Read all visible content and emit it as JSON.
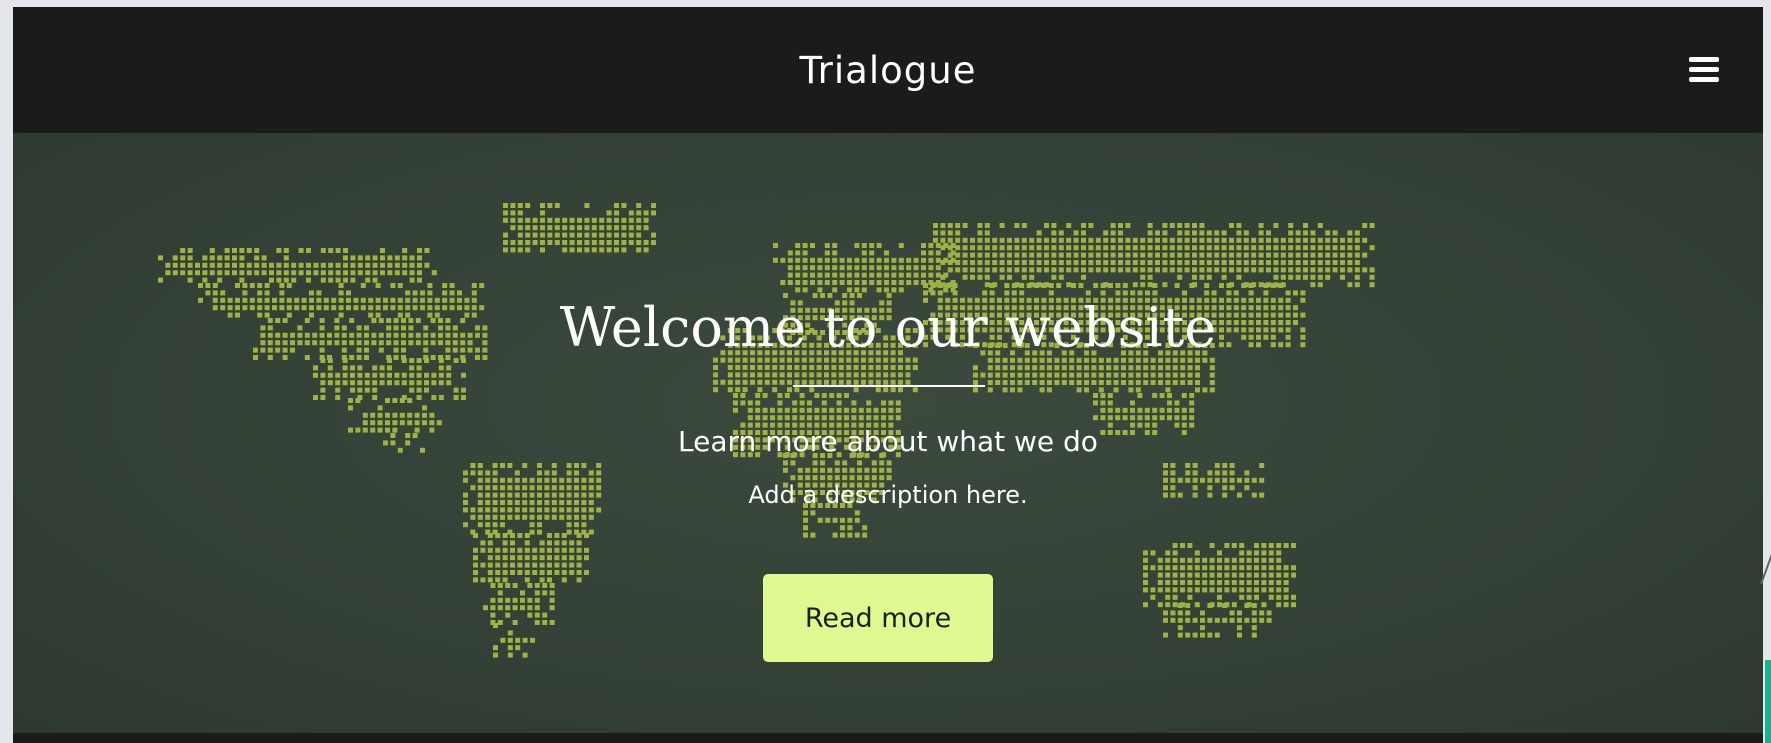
{
  "header": {
    "brand": "Trialogue",
    "menu_icon": "hamburger-menu-icon"
  },
  "hero": {
    "background_image": "world-dot-map",
    "title": "Welcome to our website",
    "subtitle": "Learn more about what we do",
    "description": "Add a description here.",
    "button_label": "Read more"
  },
  "colors": {
    "header_bg": "#1b1b1b",
    "hero_bg": "#344136",
    "map_dots": "#9fb243",
    "button_bg": "#ddf98f",
    "text": "#ffffff",
    "accent": "#19b394"
  }
}
